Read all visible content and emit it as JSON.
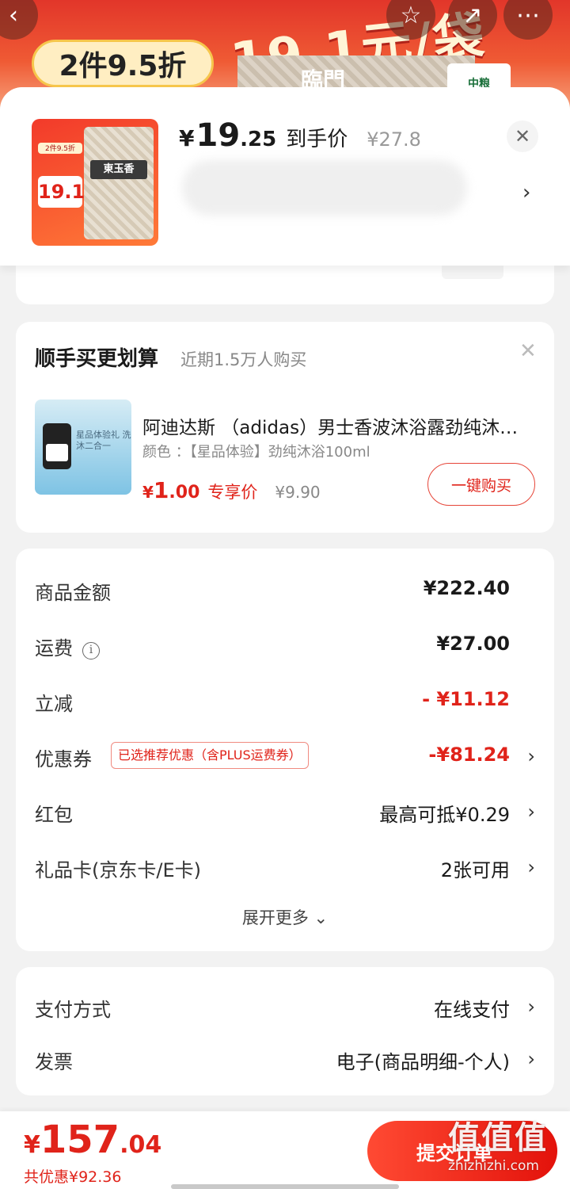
{
  "banner": {
    "badge": "2件9.5折",
    "promo": "19.1元/袋",
    "brand": "臨門",
    "cofco": "中粮"
  },
  "product": {
    "thumb_badge": "2件9.5折",
    "thumb_price": "19.1",
    "thumb_name": "東玉香",
    "price_currency": "¥",
    "price_int": "19",
    "price_dec": ".25",
    "price_tag": "到手价",
    "original_price": "¥27.8"
  },
  "bundle": {
    "title": "顺手买更划算",
    "subtitle": "近期1.5万人购买",
    "name": "阿迪达斯  （adidas）男士香波沐浴露劲纯沐浴100ml",
    "spec": "颜色 ：【星品体验】劲纯沐浴100ml",
    "img_text": "星品体验礼 洗沐二合一",
    "price_currency": "¥",
    "price_int": "1",
    "price_dec": ".00",
    "price_tag": "专享价",
    "original_price": "¥9.90",
    "buy_label": "一键购买"
  },
  "fees": {
    "goods_label": "商品金额",
    "goods_value": "¥222.40",
    "shipping_label": "运费",
    "shipping_value": "¥27.00",
    "discount_label": "立减",
    "discount_value": "- ¥11.12",
    "coupon_label": "优惠券",
    "coupon_tag": "已选推荐优惠（含PLUS运费券）",
    "coupon_value": "-¥81.24",
    "redpacket_label": "红包",
    "redpacket_value": "最高可抵¥0.29",
    "giftcard_label": "礼品卡(京东卡/E卡)",
    "giftcard_value": "2张可用",
    "expand_label": "展开更多"
  },
  "payment": {
    "method_label": "支付方式",
    "method_value": "在线支付",
    "invoice_label": "发票",
    "invoice_value": "电子(商品明细-个人)"
  },
  "checkout": {
    "total_currency": "¥",
    "total_int": "157",
    "total_dec": ".04",
    "saved": "共优惠¥92.36",
    "submit_label": "提交订单"
  },
  "watermark": {
    "big": "值值值",
    "small": "zhizhizhi.com"
  },
  "icons": {
    "back": "chevron-left-icon",
    "favorite": "star-icon",
    "share": "share-icon",
    "more": "more-icon",
    "close": "close-icon",
    "arrow": "chevron-right-icon",
    "info": "info-icon"
  },
  "colors": {
    "accent": "#e0231a",
    "background": "#f2f2f2"
  }
}
